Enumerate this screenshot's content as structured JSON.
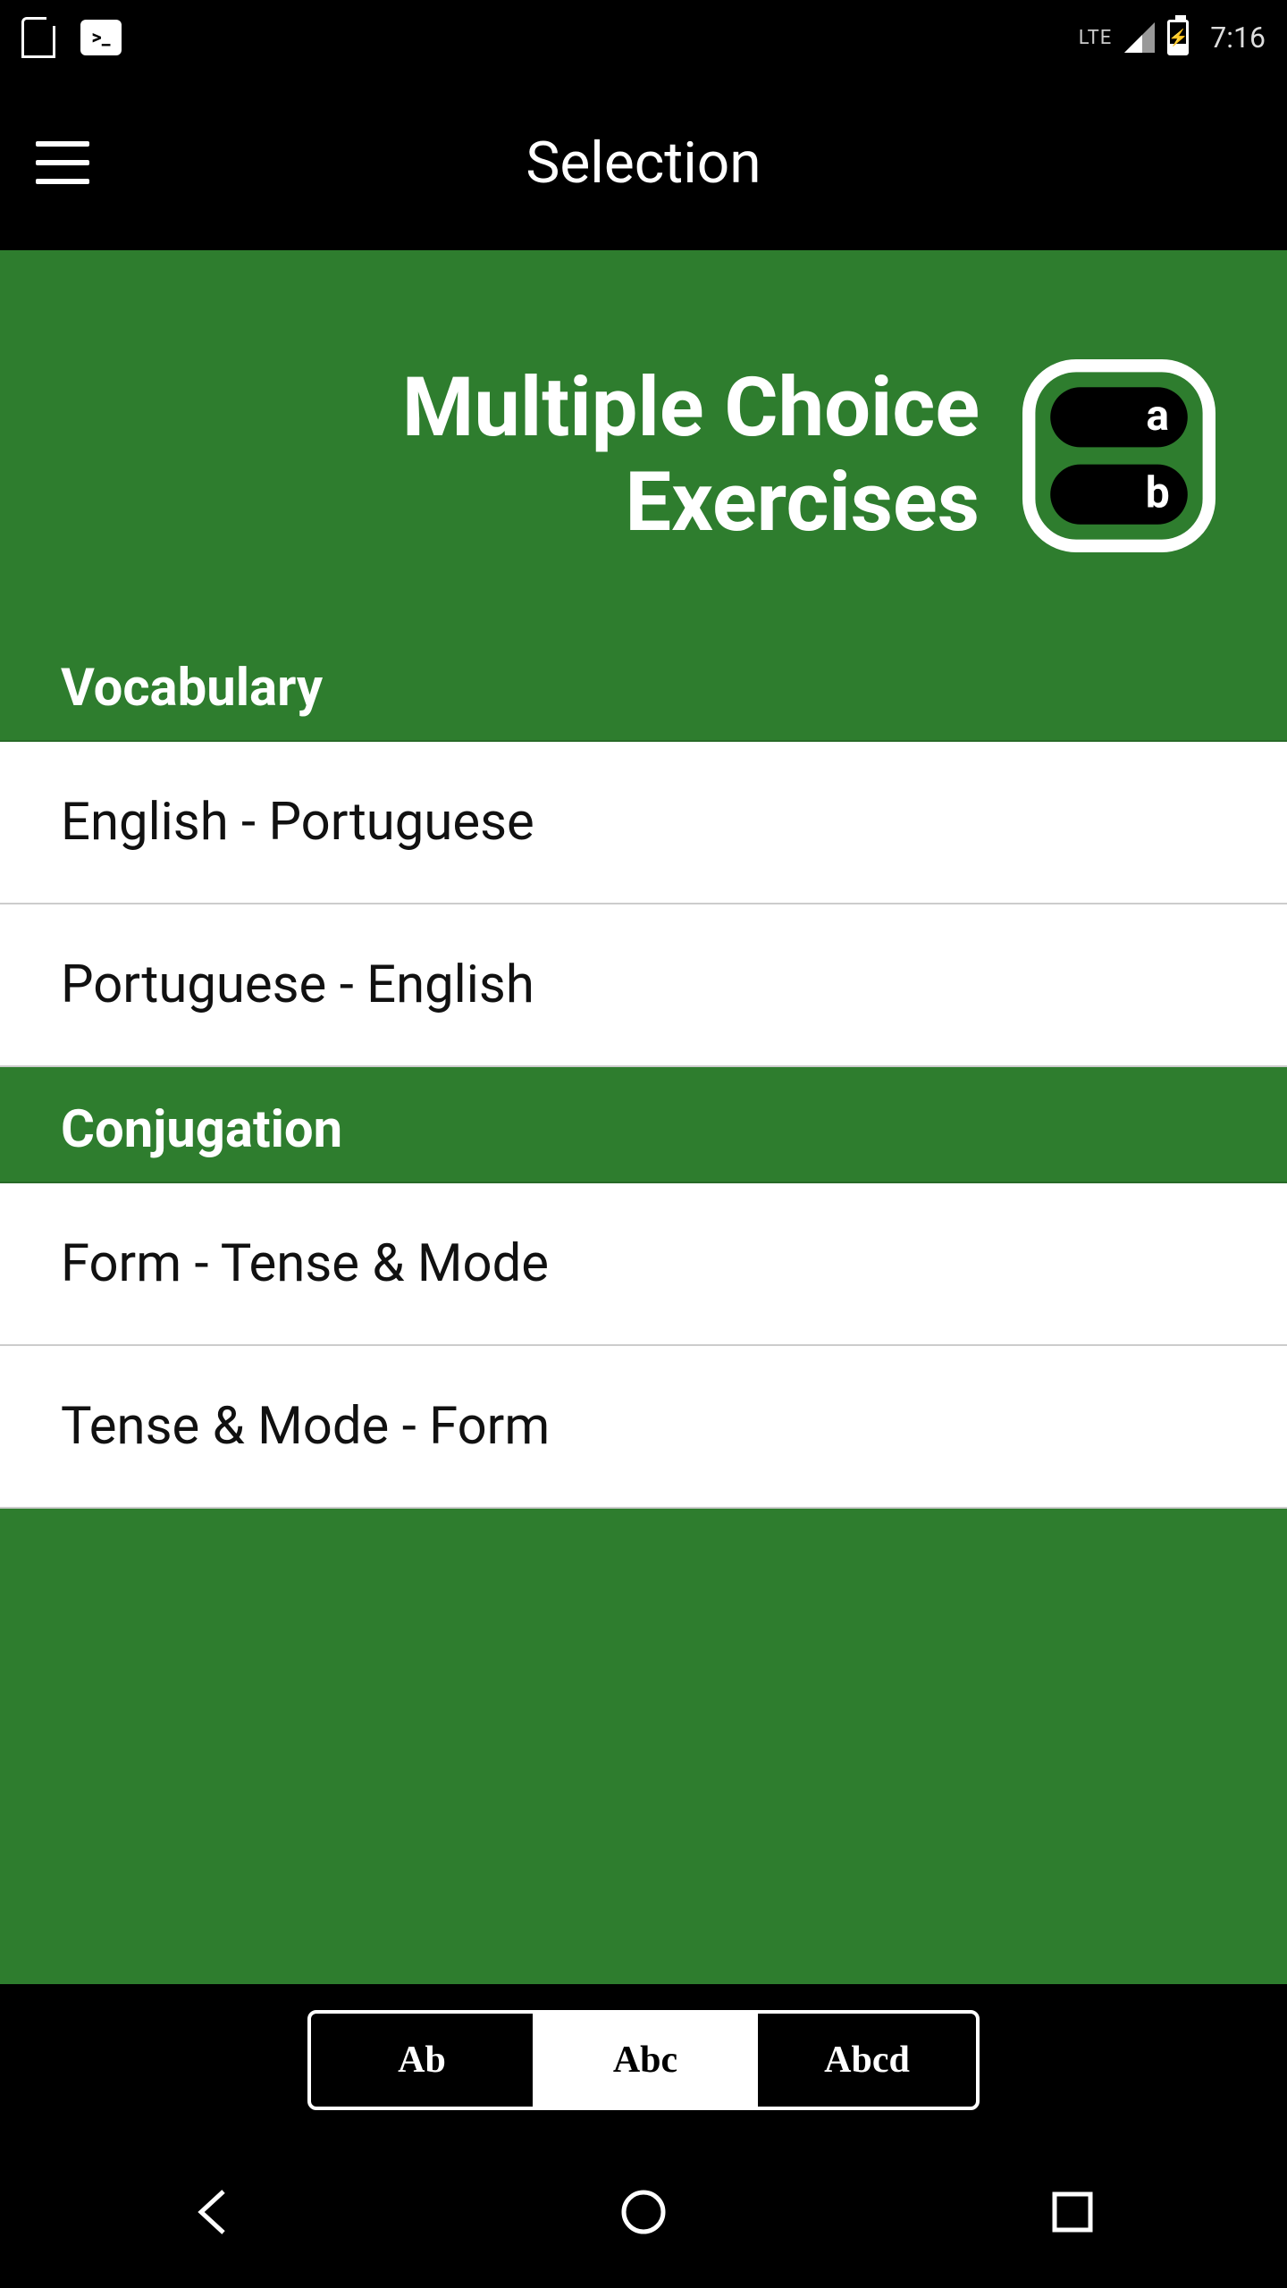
{
  "status": {
    "network_label": "LTE",
    "clock": "7:16",
    "terminal_glyph": ">_"
  },
  "appbar": {
    "title": "Selection"
  },
  "hero": {
    "line1": "Multiple Choice",
    "line2": "Exercises"
  },
  "sections": [
    {
      "header": "Vocabulary",
      "items": [
        "English - Portuguese",
        "Portuguese - English"
      ]
    },
    {
      "header": "Conjugation",
      "items": [
        "Form - Tense & Mode",
        "Tense & Mode - Form"
      ]
    }
  ],
  "segmented": {
    "options": [
      "Ab",
      "Abc",
      "Abcd"
    ],
    "active_index": 1
  },
  "colors": {
    "primary_green": "#2e7d2e",
    "black": "#000000",
    "white": "#ffffff"
  }
}
